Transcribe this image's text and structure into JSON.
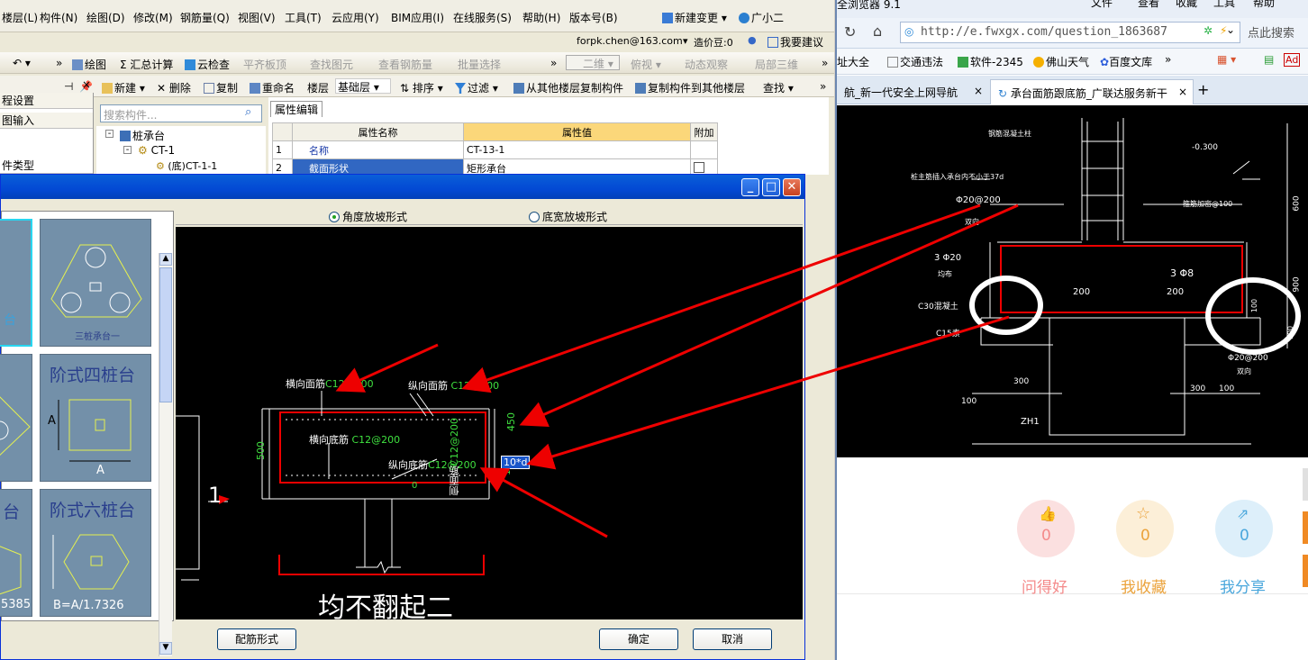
{
  "app": {
    "menu": [
      "楼层(L)",
      "构件(N)",
      "绘图(D)",
      "修改(M)",
      "钢筋量(Q)",
      "视图(V)",
      "工具(T)",
      "云应用(Y)",
      "BIM应用(I)",
      "在线服务(S)",
      "帮助(H)",
      "版本号(B)",
      "新建变更",
      "广小二"
    ],
    "account": "forpk.chen@163.com",
    "price": "造价豆:0",
    "suggest": "我要建议",
    "toolbar1": [
      "绘图",
      "汇总计算",
      "云检查",
      "平齐板顶",
      "查找图元",
      "查看钢筋量",
      "批量选择",
      "二维",
      "俯视",
      "动态观察",
      "局部三维"
    ],
    "toolbar2": [
      "新建",
      "删除",
      "复制",
      "重命名",
      "楼层",
      "基础层",
      "排序",
      "过滤",
      "从其他楼层复制构件",
      "复制构件到其他楼层",
      "查找"
    ],
    "left_rows": [
      "程设置",
      "图输入",
      "件类型"
    ],
    "search_placeholder": "搜索构件...",
    "tree": [
      "桩承台",
      "CT-1",
      "(底)CT-1-1"
    ],
    "prop_tab": "属性编辑",
    "prop_headers": [
      "属性名称",
      "属性值",
      "附加"
    ],
    "prop_rows": [
      [
        "1",
        "名称",
        "CT-13-1"
      ],
      [
        "2",
        "截面形状",
        "矩形承台"
      ]
    ]
  },
  "dialog": {
    "radio_angle": "角度放坡形式",
    "radio_width": "底宽放坡形式",
    "thumbs": [
      "三桩承台一",
      "阶式四桩台",
      "阶式六桩台",
      "B=A/1.7326",
      "A",
      "台",
      "台",
      "5385",
      "A"
    ],
    "canvas": {
      "t1": "横向面筋",
      "t1v": "C12@200",
      "t2": "纵向面筋",
      "t2v": "C12@200",
      "t3": "横向底筋",
      "t3v": "C12@200",
      "t4": "纵向底筋",
      "t4v": "C12@200",
      "side": "侧面筋",
      "sidev": "C12@200",
      "d500": "500",
      "d450": "450",
      "d10": "10",
      "d0": "0",
      "box": "10*d",
      "one": "1",
      "bottom": "均不翻起二"
    },
    "btn_peijin": "配筋形式",
    "btn_ok": "确定",
    "btn_cancel": "取消"
  },
  "browser": {
    "title": "全浏览器 9.1",
    "menu": [
      "文件",
      "查看",
      "收藏",
      "工具",
      "帮助"
    ],
    "url": "http://e.fwxgx.com/question_1863687",
    "search": "点此搜索",
    "favs": [
      "址大全",
      "交通违法",
      "软件-2345",
      "佛山天气",
      "百度文库"
    ],
    "tabs": [
      "航_新一代安全上网导航",
      "承台面筋跟底筋_广联达服务新干"
    ],
    "cad": {
      "l1": "钢筋混凝土柱",
      "l2": "桩主筋插入承台内不小于37d",
      "l3": "Φ20@200",
      "l4": "双向",
      "l5": "3 Φ20",
      "l6": "均布",
      "l7": "C30混凝土",
      "l8": "C15素",
      "l9": "200",
      "l10": "200",
      "l11": "3 Φ8",
      "l12": "箍筋加密@100",
      "l13": "-0.300",
      "l14": "600",
      "l15": "900",
      "l16": "300",
      "l17": "100",
      "l18": "ZH1",
      "l19": "300",
      "l20": "100",
      "l21": "Φ20@200",
      "l22": "双向",
      "l23": "100",
      "l24": "100"
    },
    "actions": [
      {
        "label": "问得好",
        "count": "0",
        "color": "#f48a8a",
        "bg": "#fbe0e0"
      },
      {
        "label": "我收藏",
        "count": "0",
        "color": "#eba33c",
        "bg": "#fcefd8"
      },
      {
        "label": "我分享",
        "count": "0",
        "color": "#4aa7dc",
        "bg": "#ddeffa"
      }
    ]
  }
}
